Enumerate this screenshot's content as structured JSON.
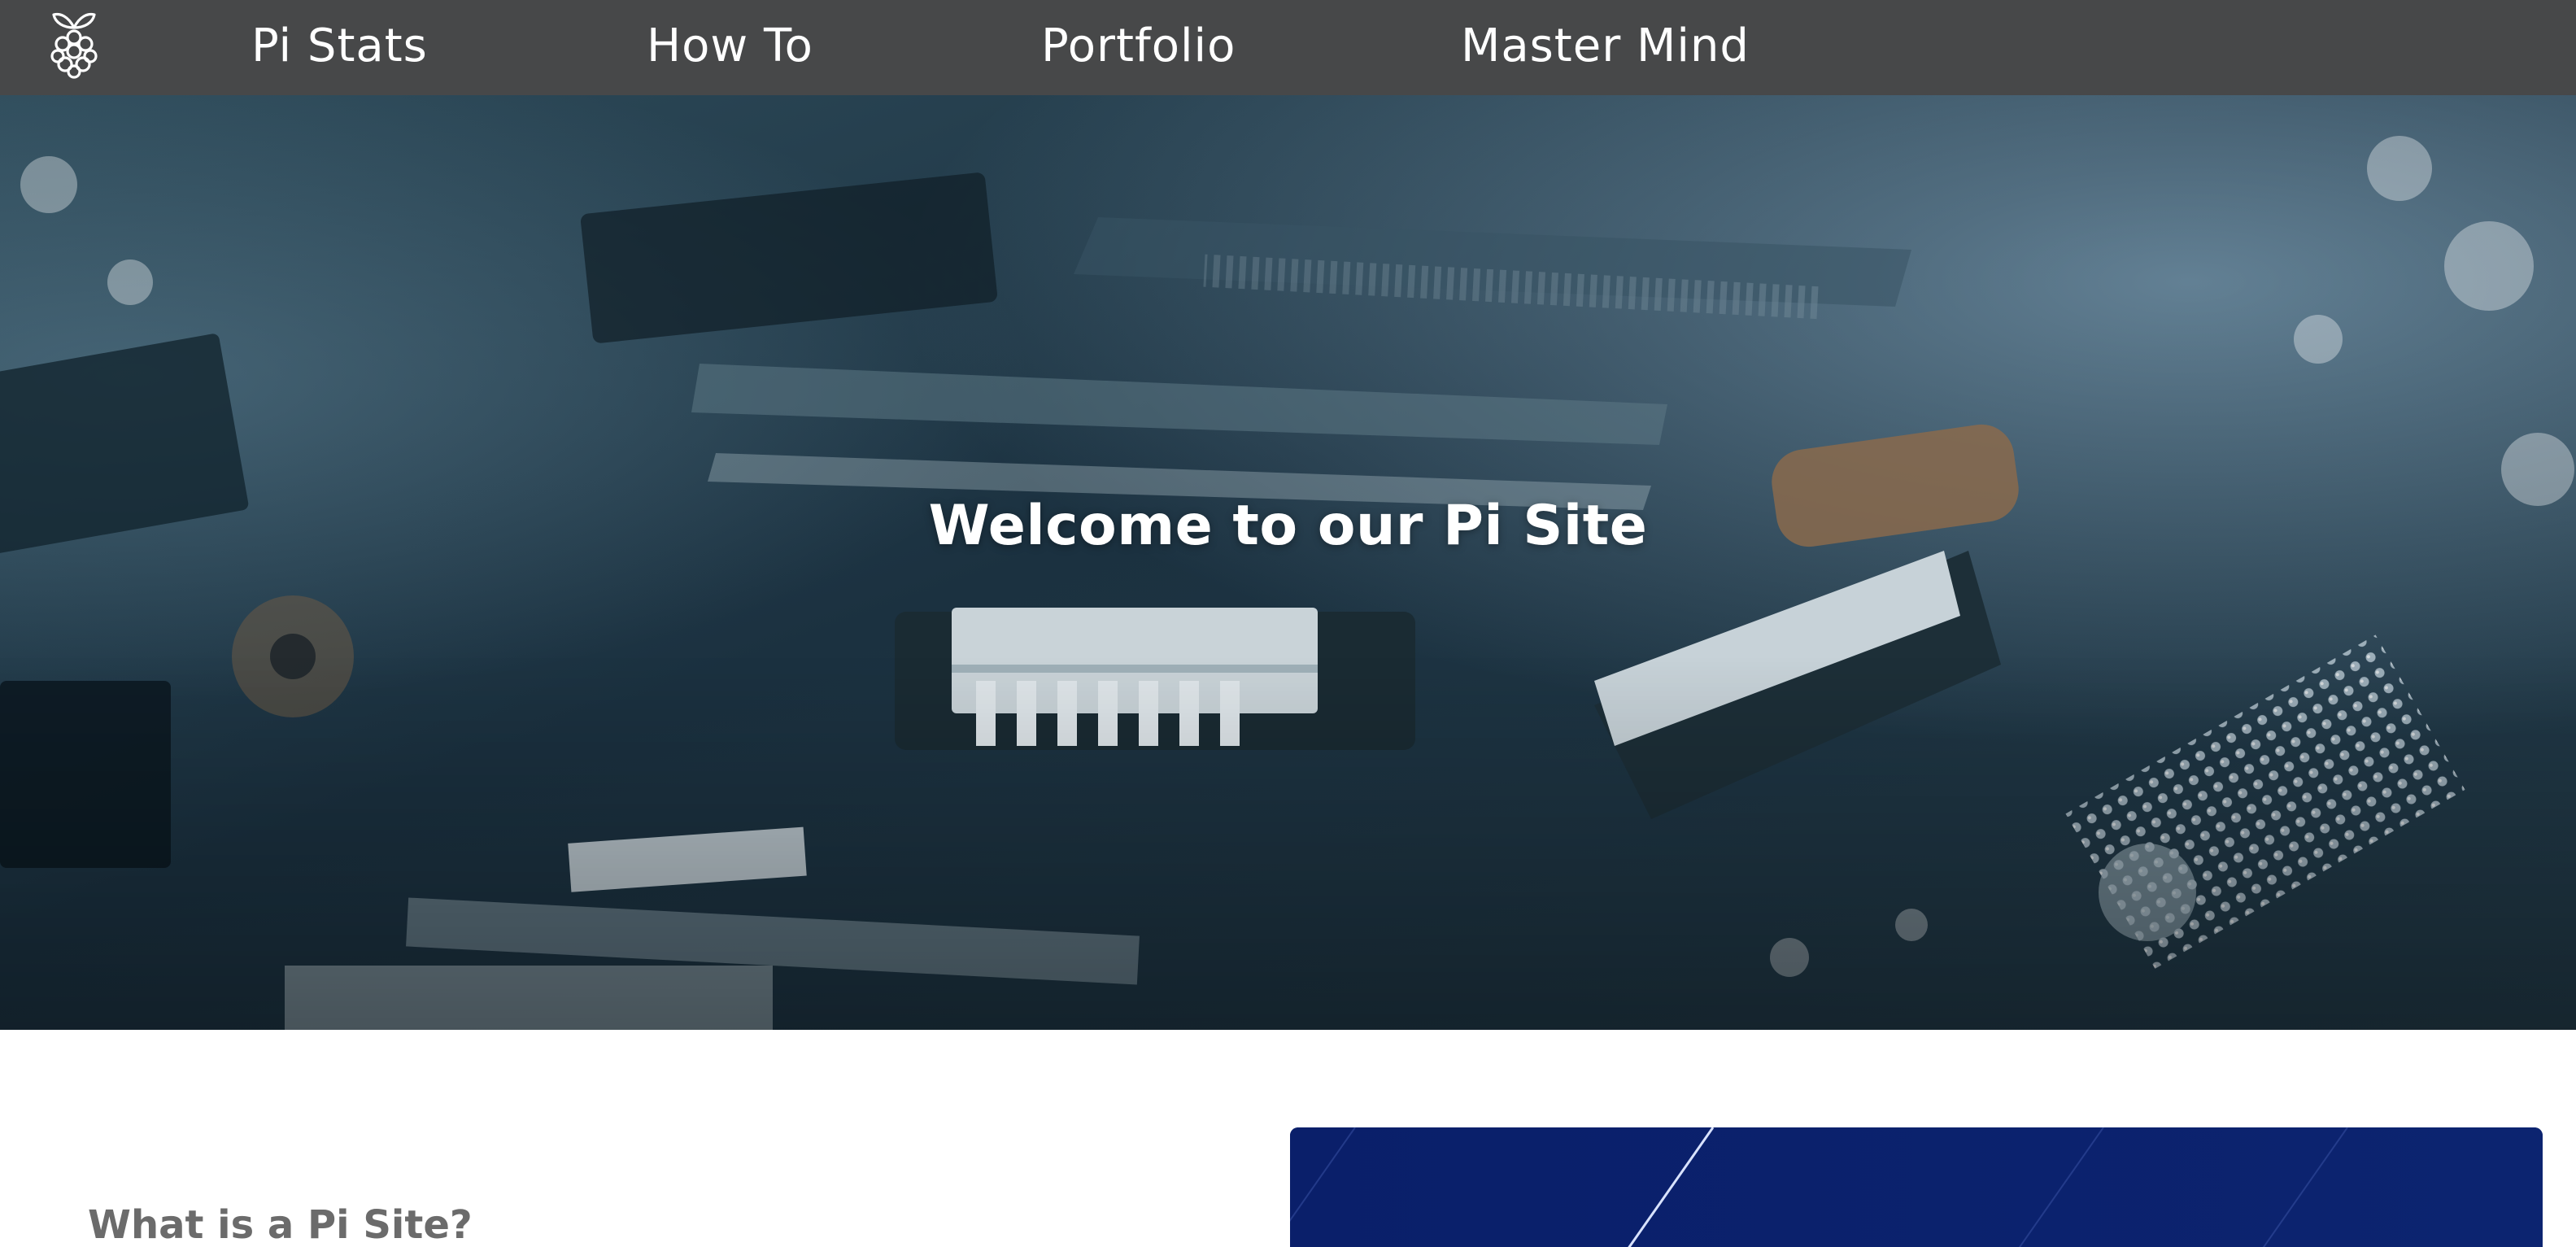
{
  "nav": {
    "logo_icon": "raspberry-pi-logo-icon",
    "items": [
      {
        "label": "Pi Stats"
      },
      {
        "label": "How To"
      },
      {
        "label": "Portfolio"
      },
      {
        "label": "Master Mind"
      }
    ]
  },
  "hero": {
    "title": "Welcome to our Pi Site",
    "background_image": "circuit-board-photo"
  },
  "intro": {
    "heading": "What is a Pi Site?"
  },
  "media": {
    "image": "blue-graphic-banner",
    "color": "#0b216c"
  },
  "colors": {
    "navbar": "#474849",
    "heading": "#6b6b6b"
  }
}
